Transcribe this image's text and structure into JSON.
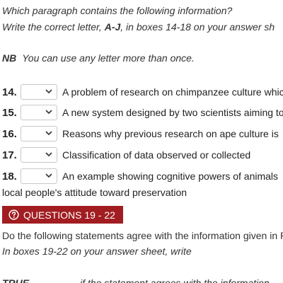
{
  "instructions": {
    "line1": "Which paragraph contains the following information?",
    "line2_prefix": "Write the correct letter, ",
    "line2_bold": "A-J",
    "line2_suffix": ", in boxes 14-18 on your answer sh",
    "nb_label": "NB",
    "nb_text": "You can use any letter more than once."
  },
  "questions": [
    {
      "number": "14.",
      "text": "A problem of research on chimpanzee culture whic"
    },
    {
      "number": "15.",
      "text": "A new system designed by two scientists aiming to"
    },
    {
      "number": "16.",
      "text": "Reasons why previous research on ape culture is"
    },
    {
      "number": "17.",
      "text": "Classification of data observed or collected"
    },
    {
      "number": "18.",
      "text": "An example showing cognitive powers of animals"
    }
  ],
  "q18_continuation": "local people's attitude toward preservation",
  "section": {
    "icon": "question-circle-icon",
    "title": "QUESTIONS 19 - 22",
    "color": "#a11d21"
  },
  "section_instructions": {
    "line1": "Do the following statements agree with the information given in R",
    "line2": "In boxes 19-22 on your answer sheet, write",
    "true_label": "TRUE",
    "true_text": "if the statement agrees with the information"
  }
}
